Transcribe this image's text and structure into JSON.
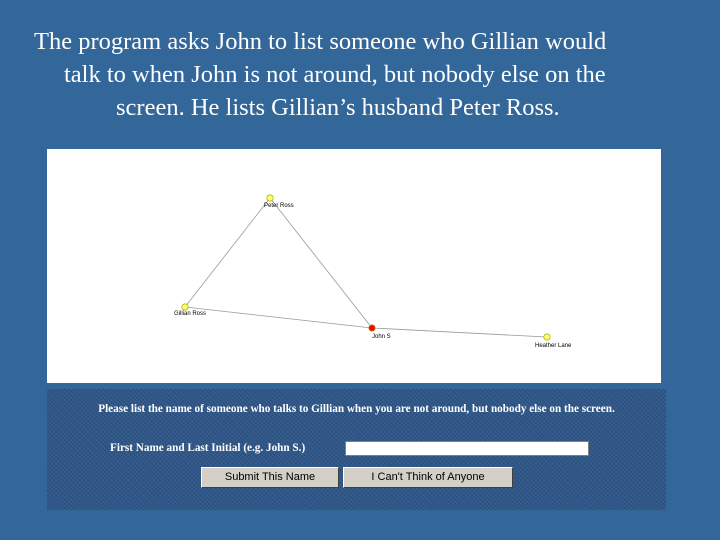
{
  "caption": {
    "line1": "The program asks John to list someone who Gillian would",
    "line2": "talk to when John is not around, but nobody else on the",
    "line3": "screen.  He lists Gillian’s husband Peter Ross."
  },
  "graph": {
    "nodes": [
      {
        "id": "peter",
        "label": "Peter Ross",
        "color": "#ffff66"
      },
      {
        "id": "gillian",
        "label": "Gillian Ross",
        "color": "#ffff66"
      },
      {
        "id": "john",
        "label": "John S",
        "color": "#ff0000"
      },
      {
        "id": "heather",
        "label": "Heather Lane",
        "color": "#ffff66"
      }
    ],
    "edges": [
      [
        "peter",
        "gillian"
      ],
      [
        "peter",
        "john"
      ],
      [
        "gillian",
        "john"
      ],
      [
        "john",
        "heather"
      ]
    ]
  },
  "form": {
    "prompt": "Please list the name of someone who talks to Gillian when you are not around, but nobody else on the screen.",
    "field_label": "First Name and Last Initial (e.g. John S.)",
    "name_value": "",
    "submit_label": "Submit This Name",
    "cant_label": "I Can't Think of Anyone"
  },
  "colors": {
    "background": "#336699",
    "form_panel": "#2f5688",
    "edge": "#999999"
  }
}
